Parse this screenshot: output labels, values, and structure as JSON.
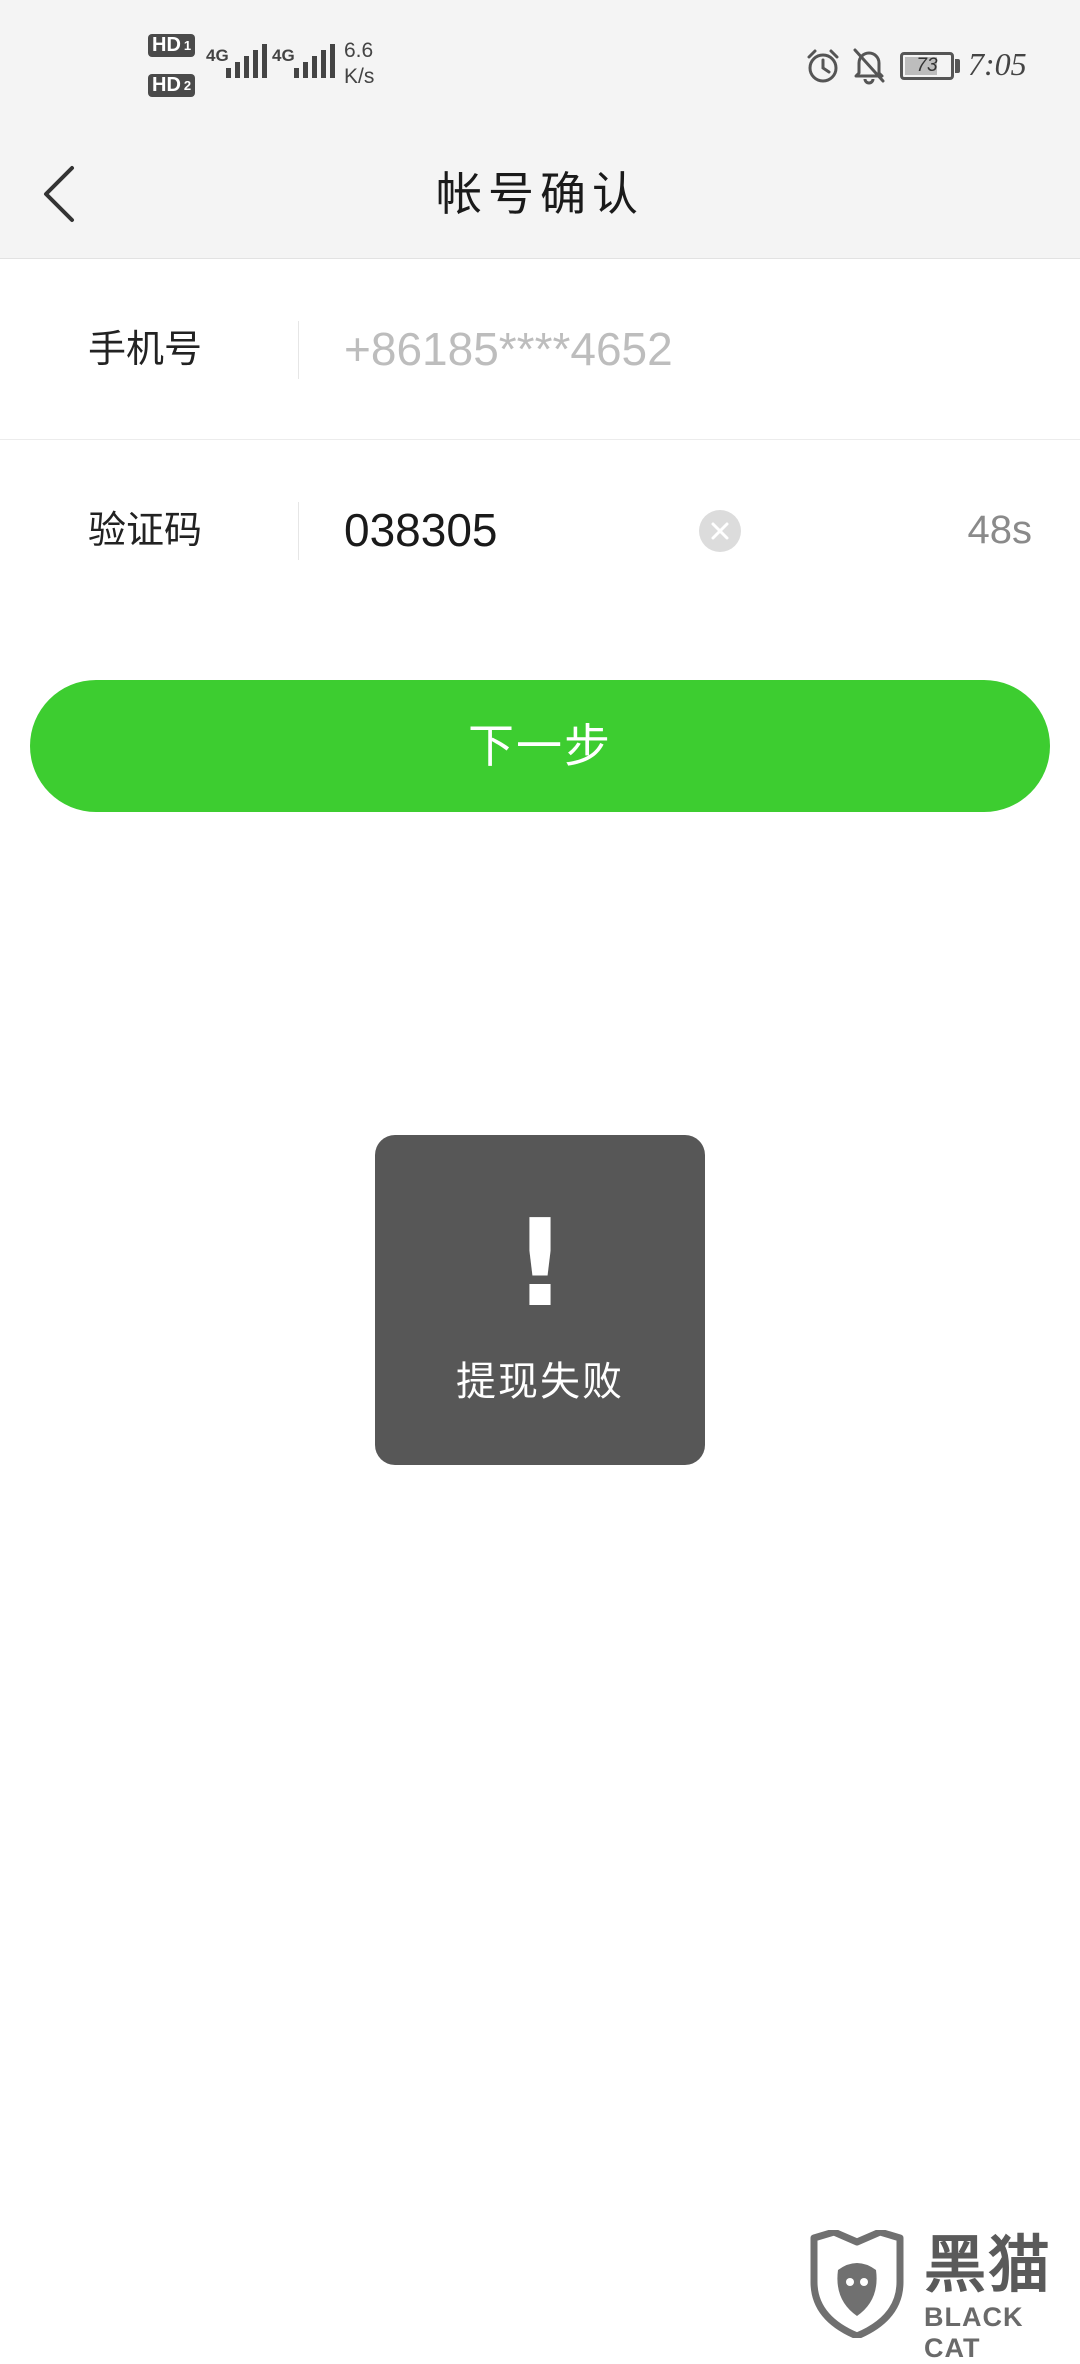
{
  "status_bar": {
    "sim1": "HD",
    "sim1_index": "1",
    "sim2": "HD",
    "sim2_index": "2",
    "network1": "4G",
    "network2": "4G",
    "speed_value": "6.6",
    "speed_unit": "K/s",
    "battery": "73",
    "battery_level_percent": 73,
    "time": "7:05",
    "icons": [
      "alarm-icon",
      "notifications-off-icon",
      "battery-icon"
    ]
  },
  "nav": {
    "title": "帐号确认",
    "back_icon": "chevron-left-icon"
  },
  "form": {
    "phone_label": "手机号",
    "phone_value": "+86185****4652",
    "code_label": "验证码",
    "code_value": "038305",
    "countdown": "48s",
    "clear_icon": "clear-icon"
  },
  "next_button": {
    "label": "下一步",
    "color": "#3dcd30"
  },
  "toast": {
    "icon": "!",
    "message": "提现失败"
  },
  "watermark": {
    "text_cn": "黑猫",
    "text_en": "BLACK CAT"
  }
}
